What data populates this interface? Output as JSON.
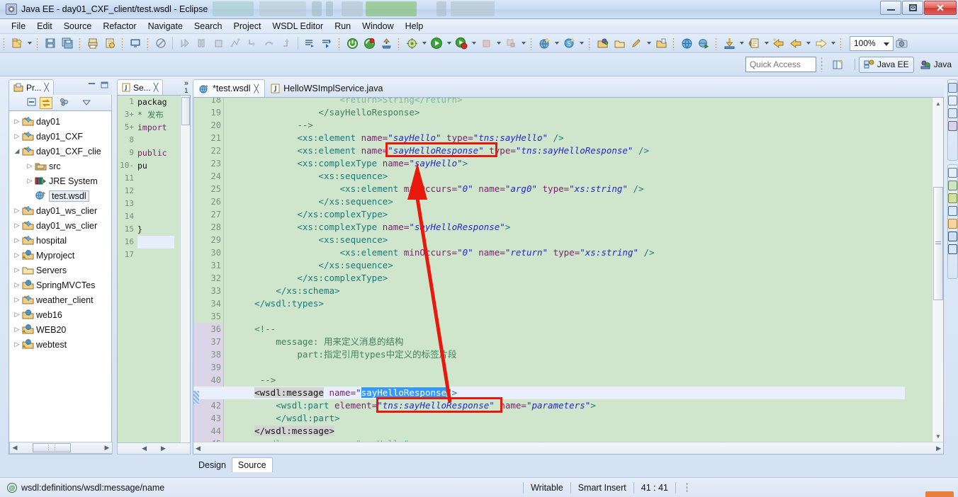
{
  "window": {
    "title": "Java EE - day01_CXF_client/test.wsdl - Eclipse",
    "app_icon": "eclipse-icon",
    "minimize": "minimize-button",
    "maximize": "maximize-button",
    "close": "close-button"
  },
  "menubar": {
    "items": [
      "File",
      "Edit",
      "Source",
      "Refactor",
      "Navigate",
      "Search",
      "Project",
      "WSDL Editor",
      "Run",
      "Window",
      "Help"
    ]
  },
  "toolbar": {
    "zoom_value": "100%",
    "icons": [
      "new-wizard-icon",
      "save-icon",
      "save-all-icon",
      "print-icon",
      "export-icon",
      "console-icon",
      "no-entry-icon",
      "debug-icon",
      "pause-icon",
      "terminate-icon",
      "step-filters-icon",
      "step-into-icon",
      "step-over-icon",
      "step-return-icon",
      "next-annotation-icon",
      "skip-breakpoints-icon",
      "power-on-icon",
      "restart-server-icon",
      "publish-icon",
      "run-ant-icon",
      "run-icon",
      "run-external-icon",
      "stop-icon",
      "stop-alt-icon",
      "new-web-service-icon",
      "search-icon",
      "open-type-icon",
      "open-task-icon",
      "pencil-icon",
      "open-resource-icon",
      "web-browser-icon",
      "run-config-icon",
      "download-icon",
      "previous-edit-icon",
      "back-icon",
      "forward-icon",
      "snapshot-icon"
    ]
  },
  "quick_access": {
    "placeholder": "Quick Access",
    "open_perspective": "open-perspective-icon",
    "perspectives": [
      {
        "label": "Java EE",
        "icon": "java-ee-perspective-icon",
        "active": true
      },
      {
        "label": "Java",
        "icon": "java-perspective-icon",
        "active": false
      }
    ]
  },
  "project_explorer": {
    "tab_label": "Pr...",
    "tab_icon": "project-explorer-icon",
    "close_icon": "close-icon",
    "minimize_icon": "minimize-view-icon",
    "maximize_icon": "maximize-view-icon",
    "toolbar_icons": [
      "collapse-all-icon",
      "link-with-editor-icon",
      "view-menu-icon",
      "chevron-down-icon"
    ],
    "tree": [
      {
        "label": "day01",
        "icon": "project-folder-icon",
        "indent": 0,
        "expandable": true,
        "expanded": false
      },
      {
        "label": "day01_CXF",
        "icon": "project-folder-icon",
        "indent": 0,
        "expandable": true,
        "expanded": false
      },
      {
        "label": "day01_CXF_clie",
        "icon": "project-folder-icon",
        "indent": 0,
        "expandable": true,
        "expanded": true
      },
      {
        "label": "src",
        "icon": "source-folder-icon",
        "indent": 1,
        "expandable": true,
        "expanded": false
      },
      {
        "label": "JRE System",
        "icon": "jre-library-icon",
        "indent": 1,
        "expandable": true,
        "expanded": false
      },
      {
        "label": "test.wsdl",
        "icon": "wsdl-file-icon",
        "indent": 1,
        "expandable": false,
        "selected": true
      },
      {
        "label": "day01_ws_clier",
        "icon": "project-folder-icon",
        "indent": 0,
        "expandable": true,
        "expanded": false
      },
      {
        "label": "day01_ws_clier",
        "icon": "project-folder-icon",
        "indent": 0,
        "expandable": true,
        "expanded": false
      },
      {
        "label": "hospital",
        "icon": "project-folder-icon",
        "indent": 0,
        "expandable": true,
        "expanded": false
      },
      {
        "label": "Myproject",
        "icon": "web-project-warning-icon",
        "indent": 0,
        "expandable": true,
        "expanded": false
      },
      {
        "label": "Servers",
        "icon": "plain-folder-icon",
        "indent": 0,
        "expandable": true,
        "expanded": false
      },
      {
        "label": "SpringMVCTes",
        "icon": "web-project-icon",
        "indent": 0,
        "expandable": true,
        "expanded": false
      },
      {
        "label": "weather_client",
        "icon": "project-folder-icon",
        "indent": 0,
        "expandable": true,
        "expanded": false
      },
      {
        "label": "web16",
        "icon": "web-project-icon",
        "indent": 0,
        "expandable": true,
        "expanded": false
      },
      {
        "label": "WEB20",
        "icon": "web-project-warning-icon",
        "indent": 0,
        "expandable": true,
        "expanded": false
      },
      {
        "label": "webtest",
        "icon": "web-project-warning-icon",
        "indent": 0,
        "expandable": true,
        "expanded": false
      }
    ]
  },
  "small_editor": {
    "tab_label": "Se...",
    "tab_icon": "java-file-icon",
    "close_icon": "close-icon",
    "overflow_label": "»",
    "overflow_count": "1",
    "lines": [
      {
        "no": "1",
        "text": "packag",
        "fold": ""
      },
      {
        "no": "3",
        "text": " * 发布",
        "fold": "+"
      },
      {
        "no": "5",
        "text": "import",
        "fold": "+"
      },
      {
        "no": "8",
        "text": "",
        "fold": ""
      },
      {
        "no": "9",
        "text": "public",
        "fold": ""
      },
      {
        "no": "10",
        "text": "    pu",
        "fold": "-"
      },
      {
        "no": "11",
        "text": "",
        "fold": ""
      },
      {
        "no": "12",
        "text": "",
        "fold": ""
      },
      {
        "no": "13",
        "text": "",
        "fold": ""
      },
      {
        "no": "14",
        "text": "",
        "fold": ""
      },
      {
        "no": "15",
        "text": "    }",
        "fold": ""
      },
      {
        "no": "16",
        "text": "}",
        "fold": ""
      },
      {
        "no": "17",
        "text": "",
        "fold": ""
      }
    ]
  },
  "editor": {
    "tabs": [
      {
        "label": "*test.wsdl",
        "icon": "wsdl-file-icon",
        "active": true,
        "close_icon": "close-icon"
      },
      {
        "label": "HelloWSImplService.java",
        "icon": "java-file-icon",
        "active": false
      }
    ],
    "bottom_tabs": [
      {
        "label": "Design",
        "active": false
      },
      {
        "label": "Source",
        "active": true
      }
    ],
    "scroll_up_icon": "scroll-up-arrow",
    "scroll_down_icon": "scroll-down-arrow",
    "lines": [
      {
        "no": "18",
        "fold": "",
        "clipped": true,
        "segs": [
          {
            "t": "                    ",
            "c": "plain"
          },
          {
            "t": "<return>String</return>",
            "c": "tag"
          }
        ]
      },
      {
        "no": "19",
        "fold": "",
        "segs": [
          {
            "t": "                ",
            "c": "plain"
          },
          {
            "t": "</sayHelloResponse>",
            "c": "cmt"
          }
        ]
      },
      {
        "no": "20",
        "fold": "",
        "segs": [
          {
            "t": "            ",
            "c": "plain"
          },
          {
            "t": "-->",
            "c": "cmt"
          }
        ]
      },
      {
        "no": "21",
        "fold": "",
        "segs": [
          {
            "t": "            ",
            "c": "plain"
          },
          {
            "t": "<xs:element",
            "c": "tag"
          },
          {
            "t": " name=",
            "c": "attr"
          },
          {
            "t": "\"sayHello\"",
            "c": "val"
          },
          {
            "t": " type=",
            "c": "attr"
          },
          {
            "t": "\"tns:sayHello\"",
            "c": "val"
          },
          {
            "t": " />",
            "c": "tag"
          }
        ]
      },
      {
        "no": "22",
        "fold": "",
        "segs": [
          {
            "t": "            ",
            "c": "plain"
          },
          {
            "t": "<xs:element",
            "c": "tag"
          },
          {
            "t": " name=",
            "c": "attr"
          },
          {
            "t": "\"sayHelloResponse\"",
            "c": "val"
          },
          {
            "t": " type=",
            "c": "attr"
          },
          {
            "t": "\"tns:sayHelloResponse\"",
            "c": "val"
          },
          {
            "t": " />",
            "c": "tag"
          }
        ]
      },
      {
        "no": "23",
        "fold": "-",
        "segs": [
          {
            "t": "            ",
            "c": "plain"
          },
          {
            "t": "<xs:complexType",
            "c": "tag"
          },
          {
            "t": " name=",
            "c": "attr"
          },
          {
            "t": "\"sayHello\"",
            "c": "val"
          },
          {
            "t": ">",
            "c": "tag"
          }
        ]
      },
      {
        "no": "24",
        "fold": "-",
        "segs": [
          {
            "t": "                ",
            "c": "plain"
          },
          {
            "t": "<xs:sequence>",
            "c": "tag"
          }
        ]
      },
      {
        "no": "25",
        "fold": "",
        "segs": [
          {
            "t": "                    ",
            "c": "plain"
          },
          {
            "t": "<xs:element",
            "c": "tag"
          },
          {
            "t": " minOccurs=",
            "c": "attr"
          },
          {
            "t": "\"0\"",
            "c": "val"
          },
          {
            "t": " name=",
            "c": "attr"
          },
          {
            "t": "\"arg0\"",
            "c": "val"
          },
          {
            "t": " type=",
            "c": "attr"
          },
          {
            "t": "\"xs:string\"",
            "c": "val"
          },
          {
            "t": " />",
            "c": "tag"
          }
        ]
      },
      {
        "no": "26",
        "fold": "",
        "segs": [
          {
            "t": "                ",
            "c": "plain"
          },
          {
            "t": "</xs:sequence>",
            "c": "tag"
          }
        ]
      },
      {
        "no": "27",
        "fold": "",
        "segs": [
          {
            "t": "            ",
            "c": "plain"
          },
          {
            "t": "</xs:complexType>",
            "c": "tag"
          }
        ]
      },
      {
        "no": "28",
        "fold": "-",
        "segs": [
          {
            "t": "            ",
            "c": "plain"
          },
          {
            "t": "<xs:complexType",
            "c": "tag"
          },
          {
            "t": " name=",
            "c": "attr"
          },
          {
            "t": "\"sayHelloResponse\"",
            "c": "val"
          },
          {
            "t": ">",
            "c": "tag"
          }
        ]
      },
      {
        "no": "29",
        "fold": "-",
        "segs": [
          {
            "t": "                ",
            "c": "plain"
          },
          {
            "t": "<xs:sequence>",
            "c": "tag"
          }
        ]
      },
      {
        "no": "30",
        "fold": "",
        "segs": [
          {
            "t": "                    ",
            "c": "plain"
          },
          {
            "t": "<xs:element",
            "c": "tag"
          },
          {
            "t": " minOccurs=",
            "c": "attr"
          },
          {
            "t": "\"0\"",
            "c": "val"
          },
          {
            "t": " name=",
            "c": "attr"
          },
          {
            "t": "\"return\"",
            "c": "val"
          },
          {
            "t": " type=",
            "c": "attr"
          },
          {
            "t": "\"xs:string\"",
            "c": "val"
          },
          {
            "t": " />",
            "c": "tag"
          }
        ]
      },
      {
        "no": "31",
        "fold": "",
        "segs": [
          {
            "t": "                ",
            "c": "plain"
          },
          {
            "t": "</xs:sequence>",
            "c": "tag"
          }
        ]
      },
      {
        "no": "32",
        "fold": "",
        "segs": [
          {
            "t": "            ",
            "c": "plain"
          },
          {
            "t": "</xs:complexType>",
            "c": "tag"
          }
        ]
      },
      {
        "no": "33",
        "fold": "",
        "segs": [
          {
            "t": "        ",
            "c": "plain"
          },
          {
            "t": "</xs:schema>",
            "c": "tag"
          }
        ]
      },
      {
        "no": "34",
        "fold": "",
        "segs": [
          {
            "t": "    ",
            "c": "plain"
          },
          {
            "t": "</wsdl:types>",
            "c": "tag"
          }
        ]
      },
      {
        "no": "35",
        "fold": "",
        "segs": []
      },
      {
        "no": "36",
        "fold": "-",
        "segs": [
          {
            "t": "    ",
            "c": "plain"
          },
          {
            "t": "<!--",
            "c": "cmt"
          }
        ]
      },
      {
        "no": "37",
        "fold": "",
        "segs": [
          {
            "t": "        ",
            "c": "plain"
          },
          {
            "t": "message: 用来定义消息的结构",
            "c": "cmt"
          }
        ]
      },
      {
        "no": "38",
        "fold": "",
        "segs": [
          {
            "t": "            ",
            "c": "plain"
          },
          {
            "t": "part:指定引用types中定义的标签片段",
            "c": "cmt"
          }
        ]
      },
      {
        "no": "39",
        "fold": "",
        "segs": []
      },
      {
        "no": "40",
        "fold": "",
        "segs": [
          {
            "t": "     ",
            "c": "plain"
          },
          {
            "t": "-->",
            "c": "cmt"
          }
        ]
      },
      {
        "no": "41",
        "fold": "-",
        "cursor": true,
        "segs": [
          {
            "t": "    ",
            "c": "plain"
          },
          {
            "t": "<wsdl:message",
            "c": "occ"
          },
          {
            "t": " name=",
            "c": "attr"
          },
          {
            "t": "\"",
            "c": "val"
          },
          {
            "t": "sayHelloResponse",
            "c": "selbg"
          },
          {
            "t": "\"",
            "c": "val"
          },
          {
            "t": ">",
            "c": "tag"
          }
        ]
      },
      {
        "no": "42",
        "fold": "-",
        "segs": [
          {
            "t": "        ",
            "c": "plain"
          },
          {
            "t": "<wsdl:part",
            "c": "tag"
          },
          {
            "t": " element=",
            "c": "attr"
          },
          {
            "t": "\"tns:sayHelloResponse\"",
            "c": "val"
          },
          {
            "t": " name=",
            "c": "attr"
          },
          {
            "t": "\"parameters\"",
            "c": "val"
          },
          {
            "t": ">",
            "c": "tag"
          }
        ]
      },
      {
        "no": "43",
        "fold": "",
        "segs": [
          {
            "t": "        ",
            "c": "plain"
          },
          {
            "t": "</wsdl:part>",
            "c": "tag"
          }
        ]
      },
      {
        "no": "44",
        "fold": "",
        "segs": [
          {
            "t": "    ",
            "c": "plain"
          },
          {
            "t": "</wsdl:message>",
            "c": "occ"
          }
        ]
      },
      {
        "no": "45",
        "fold": "-",
        "clipped": true,
        "segs": [
          {
            "t": "    ",
            "c": "plain"
          },
          {
            "t": "<wsdl:message name=\"sayHello\">",
            "c": "tag"
          }
        ]
      }
    ]
  },
  "annotations": {
    "highlight_boxes": [
      {
        "name": "sayHelloResponse-element-name-box"
      },
      {
        "name": "tns-sayHelloResponse-part-element-box"
      }
    ],
    "arrow": {
      "name": "red-arrow-annotation"
    }
  },
  "statusbar": {
    "selection_icon": "at-symbol-icon",
    "selection_path": "wsdl:definitions/wsdl:message/name",
    "writable": "Writable",
    "insert_mode": "Smart Insert",
    "cursor_position": "41 : 41"
  },
  "colors": {
    "editor_background": "#cfe6cd",
    "annotation_red": "#e8180c",
    "selection_blue": "#3399ff",
    "tag_teal": "#1a7a7a",
    "attr_purple": "#7a1f6e",
    "value_blue": "#2727c8",
    "comment_green": "#3f7f5f",
    "chrome_blue": "#d0e0f2"
  }
}
